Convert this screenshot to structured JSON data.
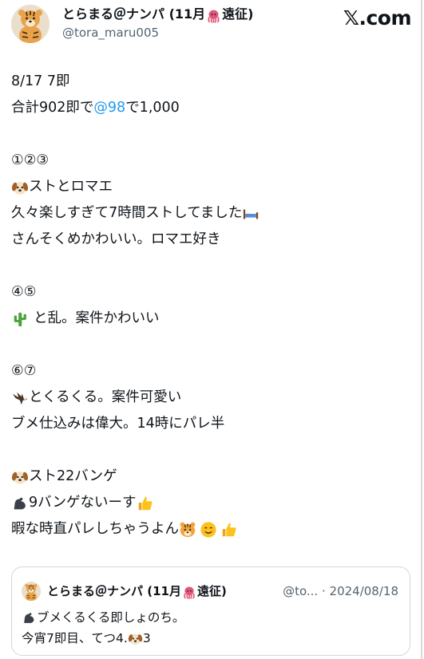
{
  "header": {
    "display_name": "とらまる＠ナンパ (11月",
    "display_name_tail": "遠征)",
    "handle": "@tora_maru005",
    "brand": "𝕏.com",
    "avatar_icon": "tiger-avatar",
    "name_emoji": "octopus-icon"
  },
  "tweet": {
    "lines": [
      {
        "text": "8/17 7即"
      },
      {
        "text_before": "合計902即で",
        "mention": "@98",
        "text_after": "で1,000"
      },
      {
        "text": ""
      },
      {
        "text": "①②③"
      },
      {
        "text": "ストとロマエ",
        "lead_icon": "dog-face-icon"
      },
      {
        "text": "久々楽しすぎて7時間ストしてました",
        "tail_icon": "bed-icon"
      },
      {
        "text": "さんそくめかわいい。ロマエ好き"
      },
      {
        "text": ""
      },
      {
        "text": "④⑤"
      },
      {
        "text": "と乱。案件かわいい",
        "lead_icon": "cactus-icon"
      },
      {
        "text": ""
      },
      {
        "text": "⑥⑦"
      },
      {
        "text": "とくるくる。案件可愛い",
        "lead_icon": "eagle-icon"
      },
      {
        "text": "ブメ仕込みは偉大。14時にパレ半"
      },
      {
        "text": ""
      },
      {
        "text": "スト22バンゲ",
        "lead_icon": "dog-face-icon"
      },
      {
        "text": "9バンゲないーす",
        "lead_icon": "flexed-bicep-icon",
        "tail_icon": "thumbs-up-icon"
      },
      {
        "text": "暇な時直パレしちゃうよん",
        "tail_icons": [
          "tiger-face-icon",
          "smiling-face-icon",
          "thumbs-up-icon"
        ]
      }
    ]
  },
  "quote": {
    "display_name": "とらまる＠ナンパ (11月",
    "display_name_tail": "遠征)",
    "handle_truncated": "@to...",
    "separator": "·",
    "date": "2024/08/18",
    "line1": "ブメくるくる即しょのち。",
    "line1_icon": "flexed-bicep-icon",
    "line2_before": "今宵7即目、てつ4.",
    "line2_icon": "dog-face-icon",
    "line2_after": "3"
  },
  "colors": {
    "text": "#0f1419",
    "secondary": "#536471",
    "mention": "#1d9bf0",
    "border": "#cfd9de"
  }
}
